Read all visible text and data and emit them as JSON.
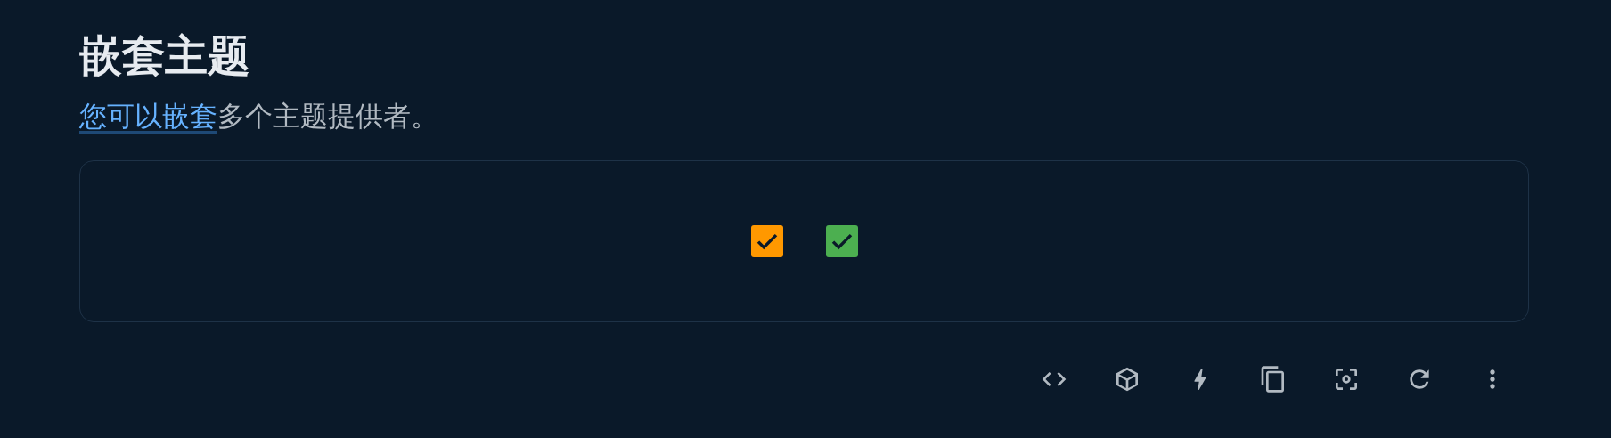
{
  "title": "嵌套主题",
  "description": {
    "link": "您可以嵌套",
    "text": "多个主题提供者。"
  },
  "checkboxes": [
    {
      "checked": true,
      "color": "#ff9800"
    },
    {
      "checked": true,
      "color": "#4caf50"
    }
  ],
  "toolbar": [
    {
      "kind": "code"
    },
    {
      "kind": "cube"
    },
    {
      "kind": "bolt"
    },
    {
      "kind": "copy"
    },
    {
      "kind": "screenshot"
    },
    {
      "kind": "reload"
    },
    {
      "kind": "more"
    }
  ]
}
